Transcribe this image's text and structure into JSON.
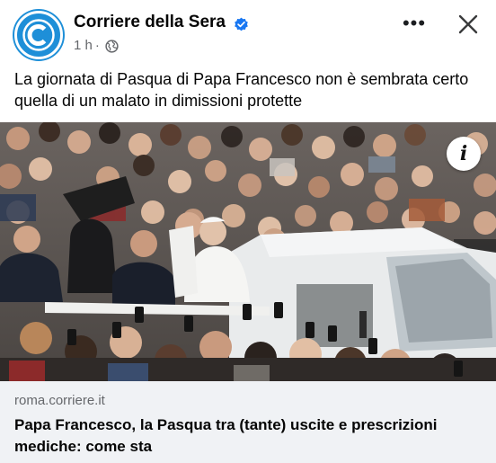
{
  "post": {
    "page_name": "Corriere della Sera",
    "time": "1 h",
    "separator": "·",
    "caption": "La giornata di Pasqua di Papa Francesco non è sembrata certo quella di un malato in dimissioni protette",
    "more_label": "•••",
    "info_label": "i"
  },
  "link": {
    "domain": "roma.corriere.it",
    "title": "Papa Francesco, la Pasqua tra (tante) uscite e prescrizioni mediche: come sta"
  },
  "colors": {
    "brand_blue": "#1e8fd8",
    "verified_blue": "#1877f2",
    "meta_gray": "#65676b",
    "link_bg": "#f0f2f5"
  },
  "icons": [
    "corriere-logo-icon",
    "verified-badge-icon",
    "globe-icon",
    "more-options-icon",
    "close-icon",
    "info-icon"
  ]
}
